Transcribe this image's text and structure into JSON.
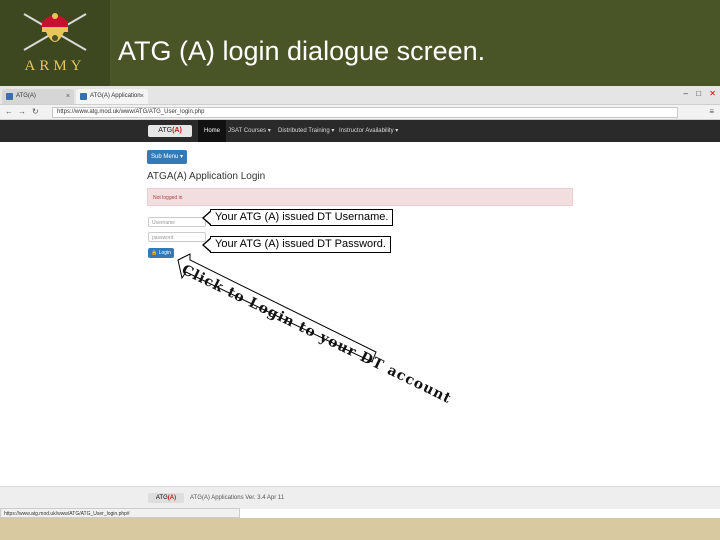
{
  "slide": {
    "title": "ATG (A) login dialogue screen.",
    "logo_text": "ARMY"
  },
  "browser": {
    "tabs": [
      {
        "label": "ATG(A)"
      },
      {
        "label": "ATG(A) Application Log"
      }
    ],
    "url": "https://www.atg.mod.uk/www/ATG/ATG_User_login.php",
    "window_controls": [
      "–",
      "□",
      "✕"
    ]
  },
  "site_nav": {
    "logo_prefix": "ATG",
    "logo_suffix": "(A)",
    "items": [
      {
        "label": "Home",
        "active": true
      },
      {
        "label": "JSAT Courses ▾",
        "active": false
      },
      {
        "label": "Distributed Training ▾",
        "active": false
      },
      {
        "label": "Instructor Availability ▾",
        "active": false
      }
    ]
  },
  "page": {
    "sub_menu_label": "Sub Menu ▾",
    "heading": "ATGA(A) Application Login",
    "alert_text": "Not logged in",
    "username_placeholder": "Username",
    "password_placeholder": "password",
    "login_button": "🔒 Login"
  },
  "annotations": {
    "username_callout": "Your ATG (A) issued DT Username.",
    "password_callout": "Your ATG (A) issued DT Password.",
    "login_instruction": "Click to Login to your DT account"
  },
  "footer": {
    "logo_prefix": "ATG",
    "logo_suffix": "(A)",
    "text": "ATG(A) Applications  Ver. 3.4 Apr 11",
    "status_url": "https://www.atg.mod.uk/www/ATG/ATG_User_login.php#"
  },
  "colors": {
    "header_bg": "#4a5527",
    "accent_blue": "#337ab7",
    "alert_bg": "#f2dede"
  }
}
